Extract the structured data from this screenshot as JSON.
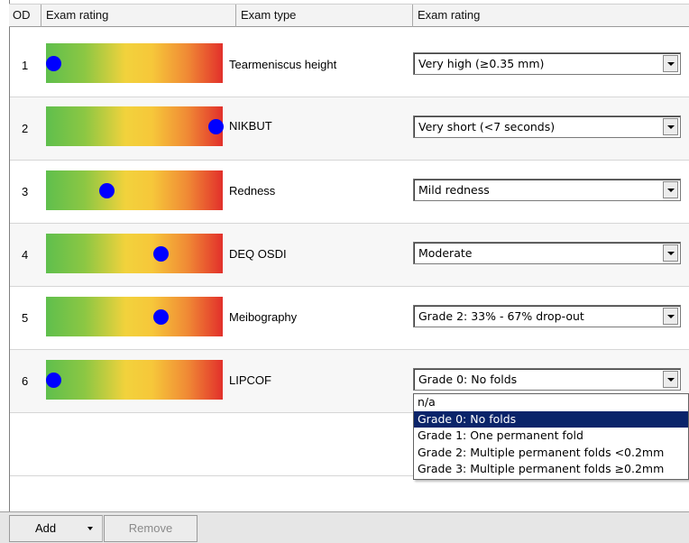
{
  "header": {
    "od": "OD",
    "rating": "Exam rating",
    "type": "Exam type",
    "select": "Exam rating"
  },
  "rows": [
    {
      "num": "1",
      "type": "Tearmeniscus height",
      "selected": "Very high (≥0.35 mm)",
      "gauge_level": 0.04
    },
    {
      "num": "2",
      "type": "NIKBUT",
      "selected": "Very short (<7 seconds)",
      "gauge_level": 0.96
    },
    {
      "num": "3",
      "type": "Redness",
      "selected": "Mild redness",
      "gauge_level": 0.34
    },
    {
      "num": "4",
      "type": "DEQ OSDI",
      "selected": "Moderate",
      "gauge_level": 0.65
    },
    {
      "num": "5",
      "type": "Meibography",
      "selected": "Grade 2: 33% - 67% drop-out",
      "gauge_level": 0.65
    },
    {
      "num": "6",
      "type": "LIPCOF",
      "selected": "Grade 0: No folds",
      "gauge_level": 0.04
    }
  ],
  "dropdown": {
    "options": [
      "n/a",
      "Grade 0: No folds",
      "Grade 1: One permanent fold",
      "Grade 2: Multiple permanent folds <0.2mm",
      "Grade 3: Multiple permanent folds ≥0.2mm"
    ],
    "selected": "Grade 0: No folds"
  },
  "toolbar": {
    "add_label": "Add",
    "remove_label": "Remove"
  },
  "colors": {
    "dot": "#0000ff",
    "selection": "#0a246a",
    "gauge_green": "#5fbf4d",
    "gauge_yellow": "#f2d23c",
    "gauge_red": "#e2302b"
  }
}
